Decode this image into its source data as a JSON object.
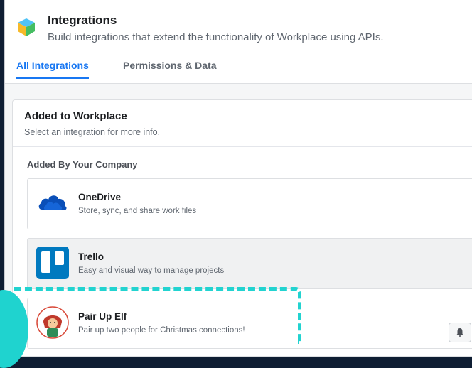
{
  "header": {
    "title": "Integrations",
    "subtitle": "Build integrations that extend the functionality of Workplace using APIs.",
    "tabs": [
      {
        "label": "All Integrations",
        "active": true
      },
      {
        "label": "Permissions & Data",
        "active": false
      }
    ]
  },
  "panel": {
    "title": "Added to Workplace",
    "subtitle": "Select an integration for more info.",
    "section_label": "Added By Your Company",
    "items": [
      {
        "name": "OneDrive",
        "desc": "Store, sync, and share work files",
        "icon": "onedrive-cloud-icon"
      },
      {
        "name": "Trello",
        "desc": "Easy and visual way to manage projects",
        "icon": "trello-icon"
      },
      {
        "name": "Pair Up Elf",
        "desc": "Pair up two people for Christmas connections!",
        "icon": "elf-avatar-icon"
      }
    ]
  },
  "colors": {
    "accent": "#1877f2",
    "highlight": "#22d3d0",
    "background": "#0f1e33"
  }
}
